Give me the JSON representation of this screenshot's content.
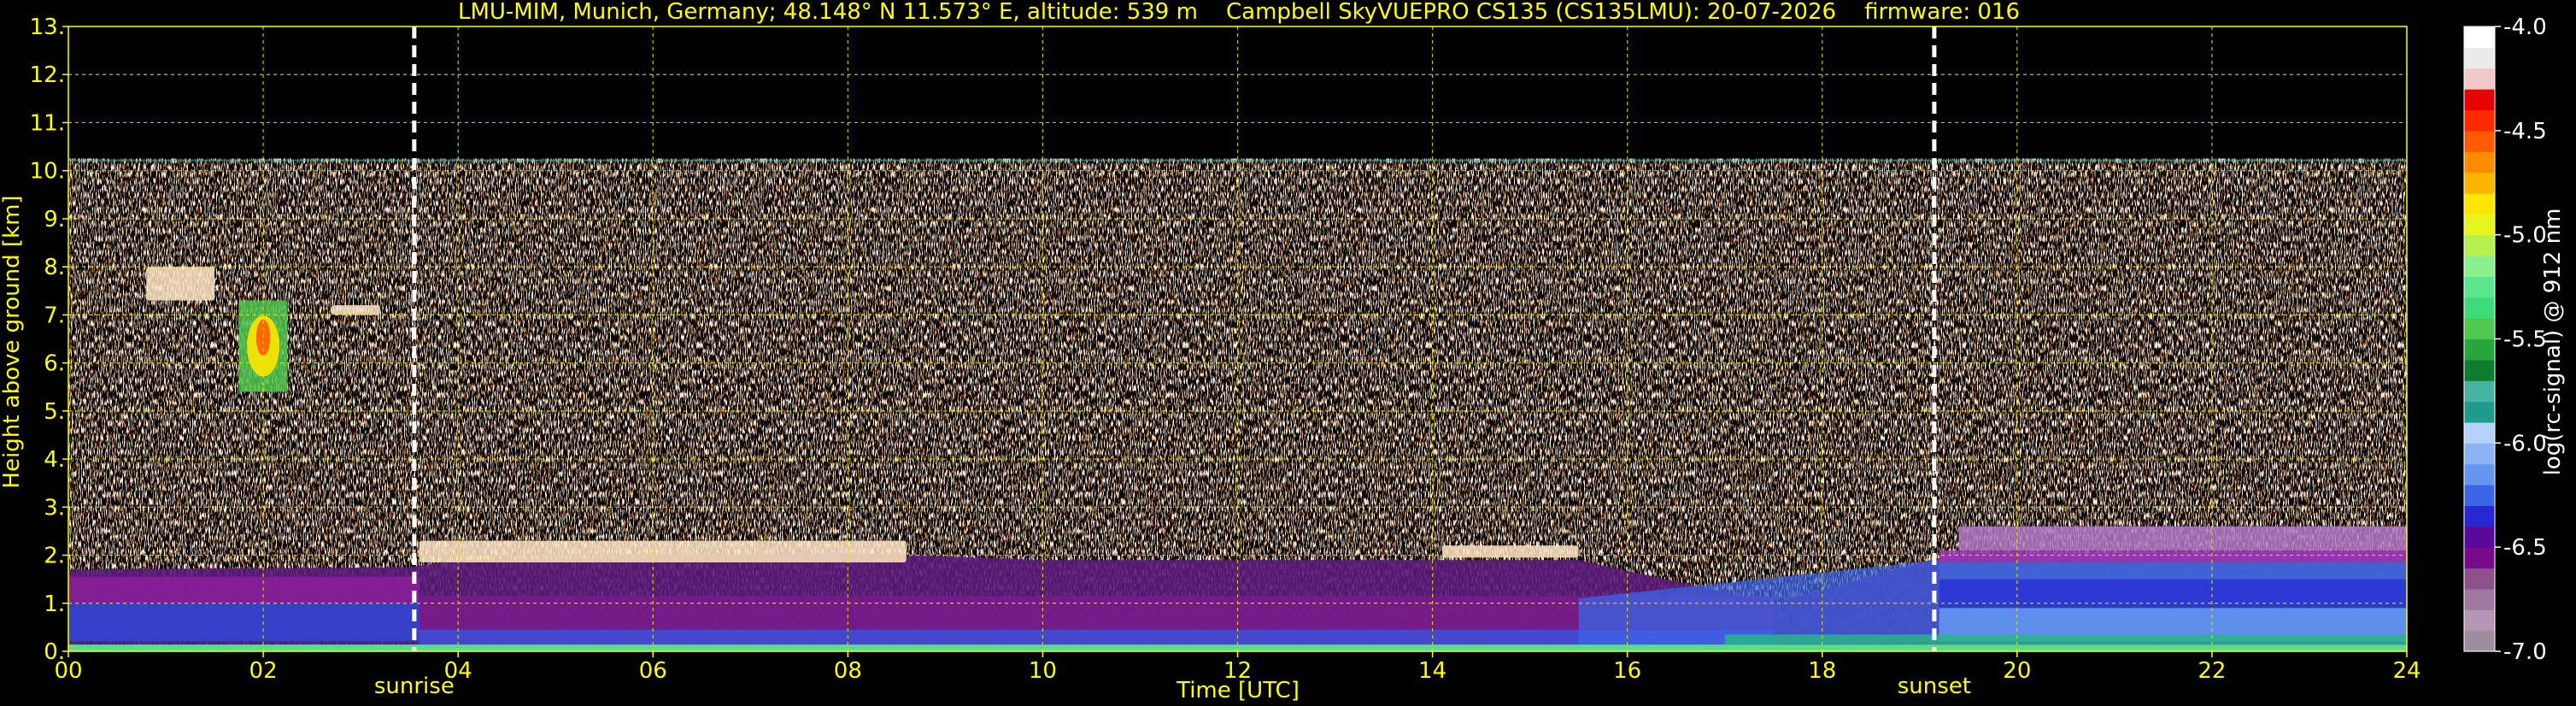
{
  "chart_data": {
    "type": "heatmap",
    "title": "LMU-MIM, Munich, Germany; 48.148° N 11.573° E, altitude: 539 m    Campbell SkyVUEPRO CS135 (CS135LMU): 20-07-2026    firmware: 016",
    "xlabel": "Time [UTC]",
    "ylabel": "Height above ground [km]",
    "xlim": [
      0,
      24
    ],
    "ylim": [
      0,
      13
    ],
    "x_ticks": [
      "00",
      "02",
      "04",
      "06",
      "08",
      "10",
      "12",
      "14",
      "16",
      "18",
      "20",
      "22",
      "24"
    ],
    "y_ticks": [
      "0.",
      "1.",
      "2.",
      "3.",
      "4.",
      "5.",
      "6.",
      "7.",
      "8.",
      "9.",
      "10.",
      "11.",
      "12.",
      "13."
    ],
    "grid": true,
    "colorbar": {
      "label": "log(rc-signal) @ 912 nm",
      "range": [
        -7.0,
        -4.0
      ],
      "ticks": [
        "-4.0",
        "-4.5",
        "-5.0",
        "-5.5",
        "-6.0",
        "-6.5",
        "-7.0"
      ],
      "colors": [
        "#a08ca0",
        "#b496b4",
        "#a078a0",
        "#8c508c",
        "#780a8c",
        "#5a0a9b",
        "#2828d2",
        "#3c64e6",
        "#6496f0",
        "#8cb4f5",
        "#b4d2fa",
        "#1e9b8c",
        "#46b4a0",
        "#0f7d2d",
        "#28a53c",
        "#50c850",
        "#3cdc78",
        "#5ae68c",
        "#8cf08c",
        "#b4f050",
        "#e6f51e",
        "#ffe600",
        "#ffb400",
        "#ff8c00",
        "#ff5a00",
        "#ff2800",
        "#e60000",
        "#f0c8c8",
        "#ebebeb",
        "#ffffff"
      ]
    },
    "markers": [
      {
        "label": "sunrise",
        "time_utc": 3.55
      },
      {
        "label": "sunset",
        "time_utc": 19.15
      }
    ],
    "features": {
      "noise_top_km": 10.25,
      "boundary_layer": [
        {
          "t": 0,
          "top_km": 1.7
        },
        {
          "t": 3.5,
          "top_km": 1.75
        },
        {
          "t": 4,
          "top_km": 1.9
        },
        {
          "t": 8,
          "top_km": 2.05
        },
        {
          "t": 10,
          "top_km": 1.9
        },
        {
          "t": 15.5,
          "top_km": 1.9
        },
        {
          "t": 17.5,
          "top_km": 1.0
        },
        {
          "t": 19.3,
          "top_km": 2.0
        },
        {
          "t": 24,
          "top_km": 2.1
        }
      ],
      "cloud_layers": [
        {
          "t_start": 0.8,
          "t_end": 1.5,
          "h_low_km": 7.3,
          "h_high_km": 8.0
        },
        {
          "t_start": 1.75,
          "t_end": 2.25,
          "h_low_km": 5.4,
          "h_high_km": 7.3
        },
        {
          "t_start": 2.7,
          "t_end": 3.2,
          "h_low_km": 7.0,
          "h_high_km": 7.2
        },
        {
          "t_start": 3.6,
          "t_end": 8.6,
          "h_low_km": 1.85,
          "h_high_km": 2.3
        },
        {
          "t_start": 14.1,
          "t_end": 15.5,
          "h_low_km": 1.95,
          "h_high_km": 2.2
        }
      ]
    }
  }
}
